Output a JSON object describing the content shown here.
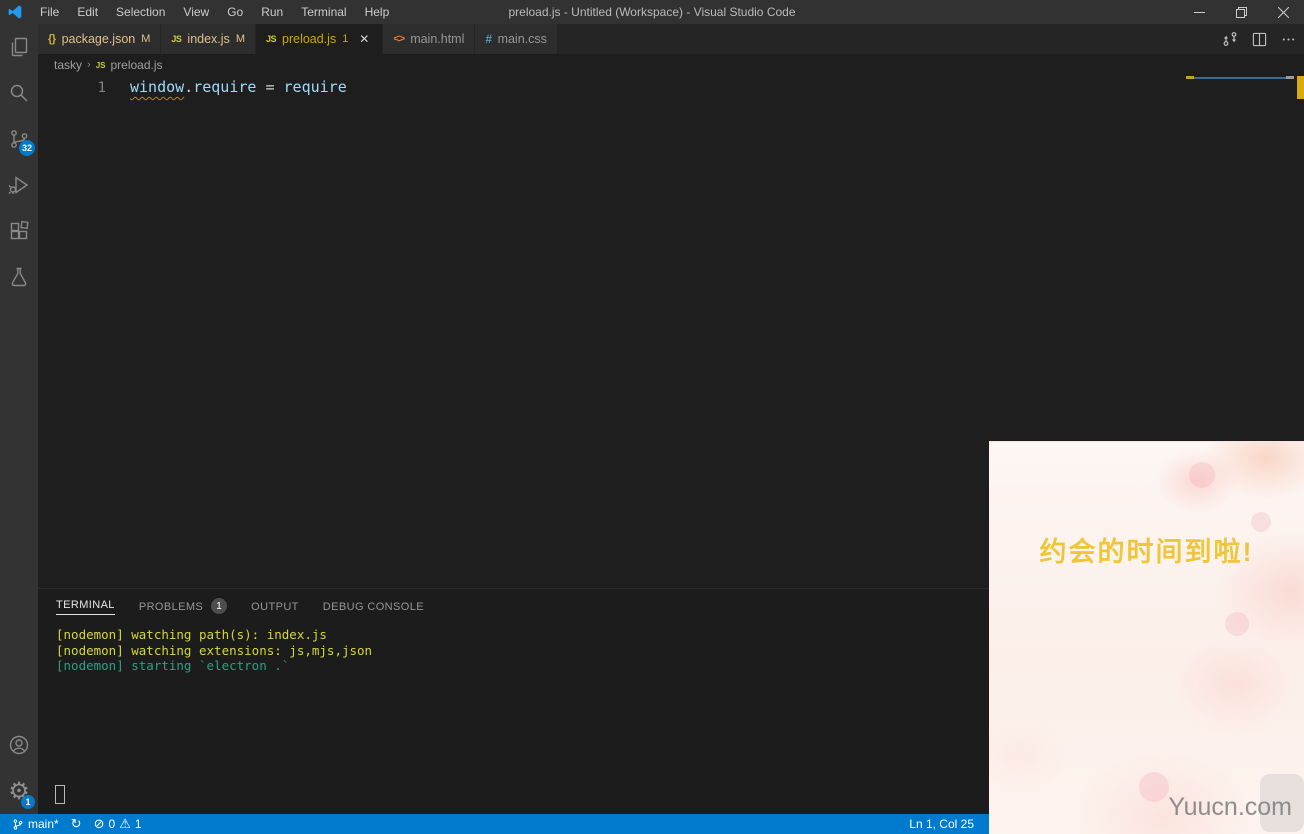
{
  "titlebar": {
    "title": "preload.js - Untitled (Workspace) - Visual Studio Code",
    "menu_items": [
      "File",
      "Edit",
      "Selection",
      "View",
      "Go",
      "Run",
      "Terminal",
      "Help"
    ]
  },
  "activity_bar": {
    "items": [
      "explorer",
      "search",
      "source-control",
      "run-and-debug",
      "extensions",
      "testing"
    ],
    "bottom_items": [
      "accounts",
      "settings"
    ],
    "source_control_badge": "32",
    "settings_badge": "1"
  },
  "tab_bar": {
    "tabs": [
      {
        "label": "package.json",
        "icon": "json-icon",
        "icon_glyph": "{}",
        "badge": "M"
      },
      {
        "label": "index.js",
        "icon": "js-icon",
        "icon_glyph": "JS",
        "badge": "M"
      },
      {
        "label": "preload.js",
        "icon": "js-icon",
        "icon_glyph": "JS",
        "badge": "1",
        "close_glyph": "✕",
        "active": true
      },
      {
        "label": "main.html",
        "icon": "html-icon",
        "icon_glyph": "<>",
        "badge": ""
      },
      {
        "label": "main.css",
        "icon": "css-icon",
        "icon_glyph": "#",
        "badge": ""
      }
    ]
  },
  "breadcrumb": {
    "folder": "tasky",
    "separator": "›",
    "file_icon_glyph": "JS",
    "file": "preload.js"
  },
  "editor": {
    "line_number": "1",
    "tokens": {
      "object": "window",
      "dot": ".",
      "property": "require",
      "operator": " = ",
      "value": "require"
    }
  },
  "panel": {
    "tabs": [
      {
        "label": "TERMINAL",
        "active": true
      },
      {
        "label": "PROBLEMS",
        "badge": "1"
      },
      {
        "label": "OUTPUT"
      },
      {
        "label": "DEBUG CONSOLE"
      }
    ],
    "terminal_lines": [
      {
        "text": "[nodemon] watching path(s): index.js",
        "color": "#d6d63f"
      },
      {
        "text": "[nodemon] watching extensions: js,mjs,json",
        "color": "#d6d63f"
      },
      {
        "text": "[nodemon] starting `electron .`",
        "color": "#2aa184"
      }
    ]
  },
  "status_bar": {
    "branch": "main*",
    "sync_glyph": "↻",
    "error_glyph": "⊘",
    "errors": "0",
    "warning_glyph": "⚠",
    "warnings": "1",
    "cursor_position": "Ln 1, Col 25"
  },
  "reminder_overlay": {
    "message": "约会的时间到啦!",
    "watermark": "Yuucn.com"
  },
  "colors": {
    "accent": "#007acc",
    "warning": "#cca700",
    "git_modified": "#e2c08d",
    "terminal_yellow": "#d6d63f",
    "terminal_green": "#2aa184",
    "reminder_text": "#f0c53a"
  }
}
